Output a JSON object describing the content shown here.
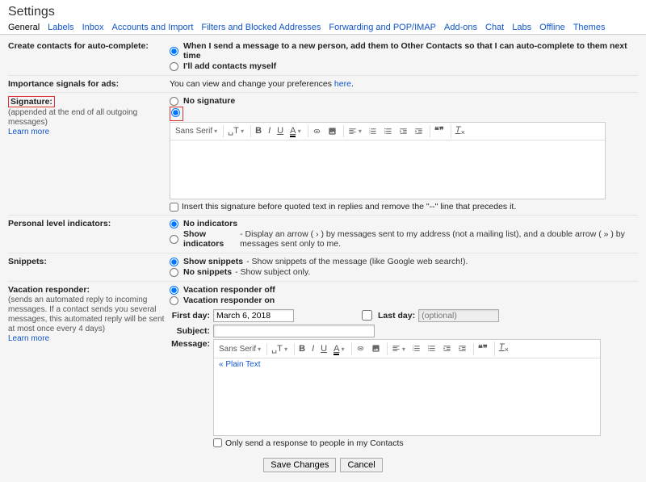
{
  "page_title": "Settings",
  "tabs": [
    {
      "label": "General",
      "active": true
    },
    {
      "label": "Labels"
    },
    {
      "label": "Inbox"
    },
    {
      "label": "Accounts and Import"
    },
    {
      "label": "Filters and Blocked Addresses"
    },
    {
      "label": "Forwarding and POP/IMAP"
    },
    {
      "label": "Add-ons"
    },
    {
      "label": "Chat"
    },
    {
      "label": "Labs"
    },
    {
      "label": "Offline"
    },
    {
      "label": "Themes"
    }
  ],
  "contacts": {
    "label": "Create contacts for auto-complete:",
    "opt1": "When I send a message to a new person, add them to Other Contacts so that I can auto-complete to them next time",
    "opt2": "I'll add contacts myself"
  },
  "ads": {
    "label": "Importance signals for ads:",
    "text_pre": "You can view and change your preferences ",
    "link": "here",
    "text_post": "."
  },
  "signature": {
    "label": "Signature:",
    "sub": "(appended at the end of all outgoing messages)",
    "learn": "Learn more",
    "opt1": "No signature",
    "font": "Sans Serif",
    "insert_check": "Insert this signature before quoted text in replies and remove the \"--\" line that precedes it."
  },
  "indicators": {
    "label": "Personal level indicators:",
    "opt1_b": "No indicators",
    "opt2_b": "Show indicators",
    "opt2_t": " - Display an arrow ( › ) by messages sent to my address (not a mailing list), and a double arrow ( » ) by messages sent only to me."
  },
  "snippets": {
    "label": "Snippets:",
    "opt1_b": "Show snippets",
    "opt1_t": " - Show snippets of the message (like Google web search!).",
    "opt2_b": "No snippets",
    "opt2_t": " - Show subject only."
  },
  "vacation": {
    "label": "Vacation responder:",
    "sub": "(sends an automated reply to incoming messages. If a contact sends you several messages, this automated reply will be sent at most once every 4 days)",
    "learn": "Learn more",
    "opt1": "Vacation responder off",
    "opt2": "Vacation responder on",
    "first_day_lbl": "First day:",
    "first_day_val": "March 6, 2018",
    "last_day_lbl": "Last day:",
    "last_day_ph": "(optional)",
    "subject_lbl": "Subject:",
    "message_lbl": "Message:",
    "font": "Sans Serif",
    "plain": "« Plain Text",
    "only_contacts": "Only send a response to people in my Contacts"
  },
  "footer": {
    "save": "Save Changes",
    "cancel": "Cancel"
  }
}
